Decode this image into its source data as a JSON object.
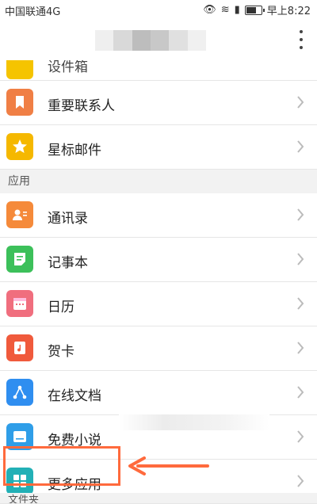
{
  "statusbar": {
    "carrier": "中国联通4G",
    "time": "早上8:22"
  },
  "partial_top": {
    "label": "设件箱"
  },
  "items_top": [
    {
      "label": "重要联系人",
      "icon": "bookmark-icon",
      "color": "#f07f45"
    },
    {
      "label": "星标邮件",
      "icon": "star-icon",
      "color": "#f5b800"
    }
  ],
  "section_apps": "应用",
  "apps": [
    {
      "label": "通讯录",
      "icon": "contacts-icon",
      "color": "#f58a3a"
    },
    {
      "label": "记事本",
      "icon": "notepad-icon",
      "color": "#3cc05a"
    },
    {
      "label": "日历",
      "icon": "calendar-icon",
      "color": "#f06e7e"
    },
    {
      "label": "贺卡",
      "icon": "card-icon",
      "color": "#f05a3c"
    },
    {
      "label": "在线文档",
      "icon": "share-doc-icon",
      "color": "#2f8ef0"
    },
    {
      "label": "免费小说",
      "icon": "book-icon",
      "color": "#2f9ee8"
    },
    {
      "label": "更多应用",
      "icon": "grid-icon",
      "color": "#22b0b6"
    }
  ],
  "section_folders": "文件夹"
}
